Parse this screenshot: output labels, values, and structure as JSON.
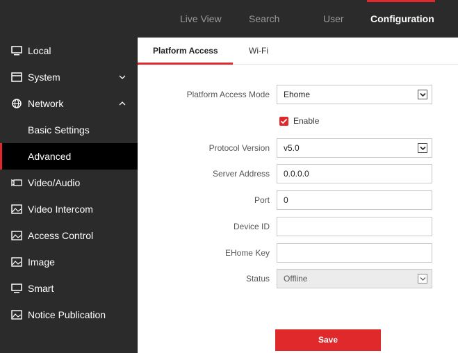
{
  "topnav": {
    "items": [
      {
        "label": "Live View"
      },
      {
        "label": "Search"
      },
      {
        "label": "User"
      },
      {
        "label": "Configuration",
        "active": true
      }
    ]
  },
  "sidebar": {
    "items": [
      {
        "label": "Local",
        "icon": "monitor-icon"
      },
      {
        "label": "System",
        "icon": "window-icon",
        "chevron": "chevron-down-icon"
      },
      {
        "label": "Network",
        "icon": "globe-icon",
        "chevron": "chevron-up-icon"
      },
      {
        "label": "Basic Settings"
      },
      {
        "label": "Advanced",
        "active": true
      },
      {
        "label": "Video/Audio",
        "icon": "camera-icon"
      },
      {
        "label": "Video Intercom",
        "icon": "image-icon"
      },
      {
        "label": "Access Control",
        "icon": "image-icon"
      },
      {
        "label": "Image",
        "icon": "image-icon"
      },
      {
        "label": "Smart",
        "icon": "monitor-icon"
      },
      {
        "label": "Notice Publication",
        "icon": "image-icon"
      }
    ]
  },
  "tabs": [
    {
      "label": "Platform Access",
      "active": true
    },
    {
      "label": "Wi-Fi"
    }
  ],
  "form": {
    "platform_access_mode": {
      "label": "Platform Access Mode",
      "value": "Ehome"
    },
    "enable": {
      "label": "Enable",
      "checked": true
    },
    "protocol_version": {
      "label": "Protocol Version",
      "value": "v5.0"
    },
    "server_address": {
      "label": "Server Address",
      "value": "0.0.0.0"
    },
    "port": {
      "label": "Port",
      "value": "0"
    },
    "device_id": {
      "label": "Device ID",
      "value": ""
    },
    "ehome_key": {
      "label": "EHome Key",
      "value": ""
    },
    "status": {
      "label": "Status",
      "value": "Offline"
    }
  },
  "save_label": "Save",
  "colors": {
    "accent": "#e0292b",
    "sidebar_bg": "#2b2b2b",
    "active_item_bg": "#000000"
  }
}
